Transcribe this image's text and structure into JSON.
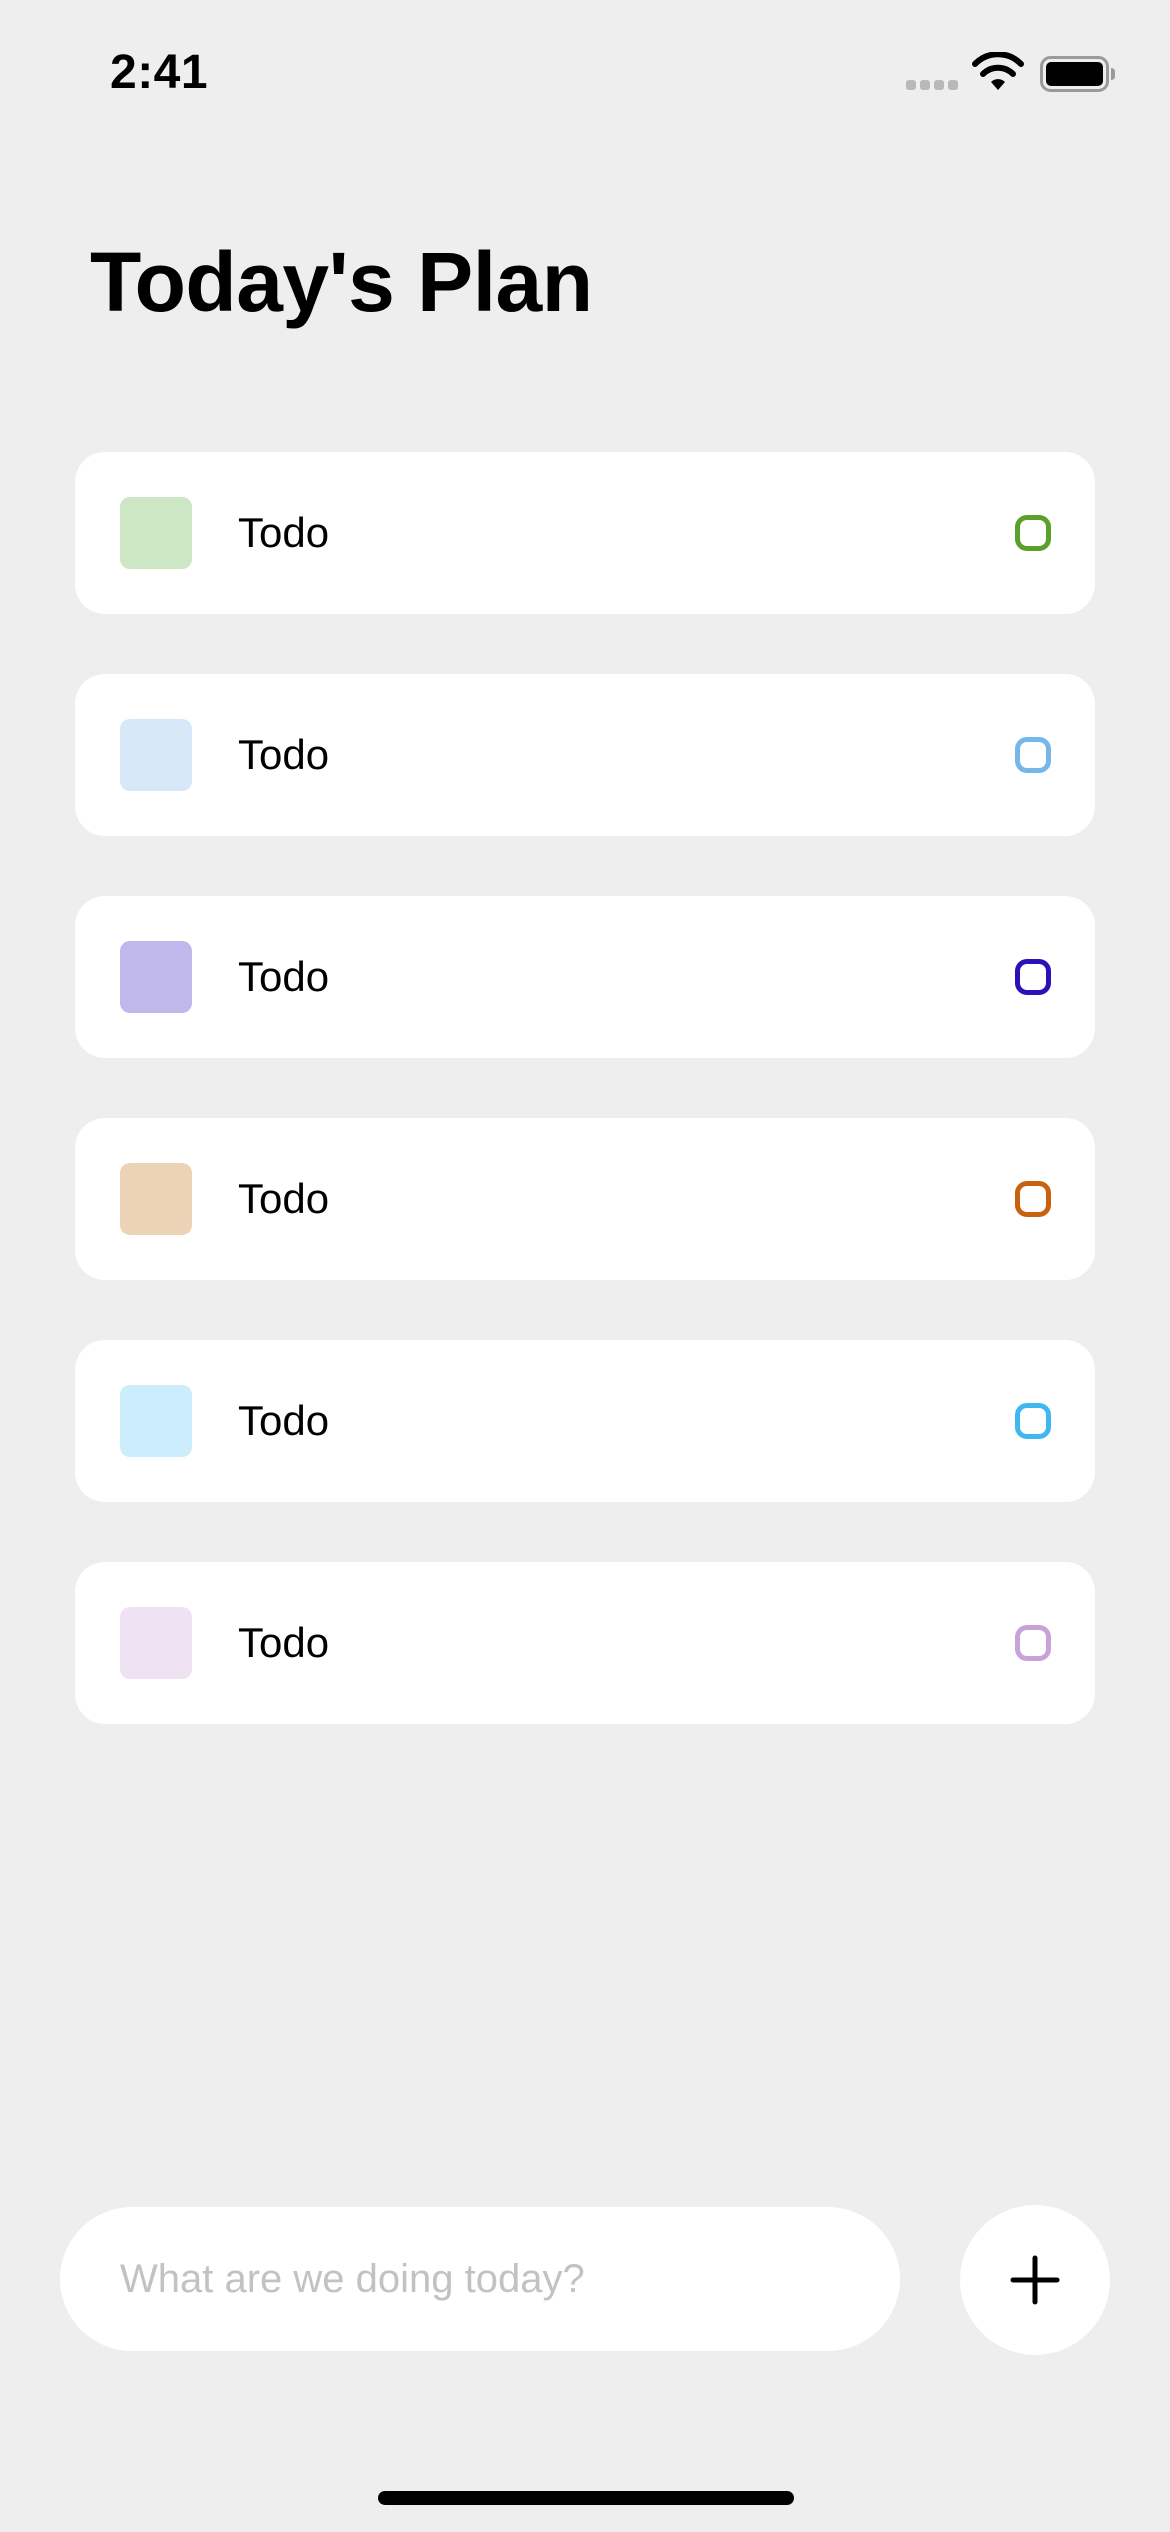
{
  "status_bar": {
    "time": "2:41",
    "signal_icon": "cellular-signal-icon",
    "wifi_icon": "wifi-icon",
    "battery_icon": "battery-icon"
  },
  "header": {
    "title": "Today's Plan"
  },
  "todos": [
    {
      "label": "Todo",
      "swatch_color": "#cde6c4",
      "check_color": "#5aa02c"
    },
    {
      "label": "Todo",
      "swatch_color": "#d6e8f8",
      "check_color": "#74b7e8"
    },
    {
      "label": "Todo",
      "swatch_color": "#c0b8ea",
      "check_color": "#2c10b8"
    },
    {
      "label": "Todo",
      "swatch_color": "#edd3b6",
      "check_color": "#c8620f"
    },
    {
      "label": "Todo",
      "swatch_color": "#cbedfc",
      "check_color": "#3fb8ef"
    },
    {
      "label": "Todo",
      "swatch_color": "#eee2f3",
      "check_color": "#c8a2d8"
    }
  ],
  "composer": {
    "input_value": "",
    "placeholder": "What are we doing today?",
    "add_icon": "plus-icon"
  }
}
